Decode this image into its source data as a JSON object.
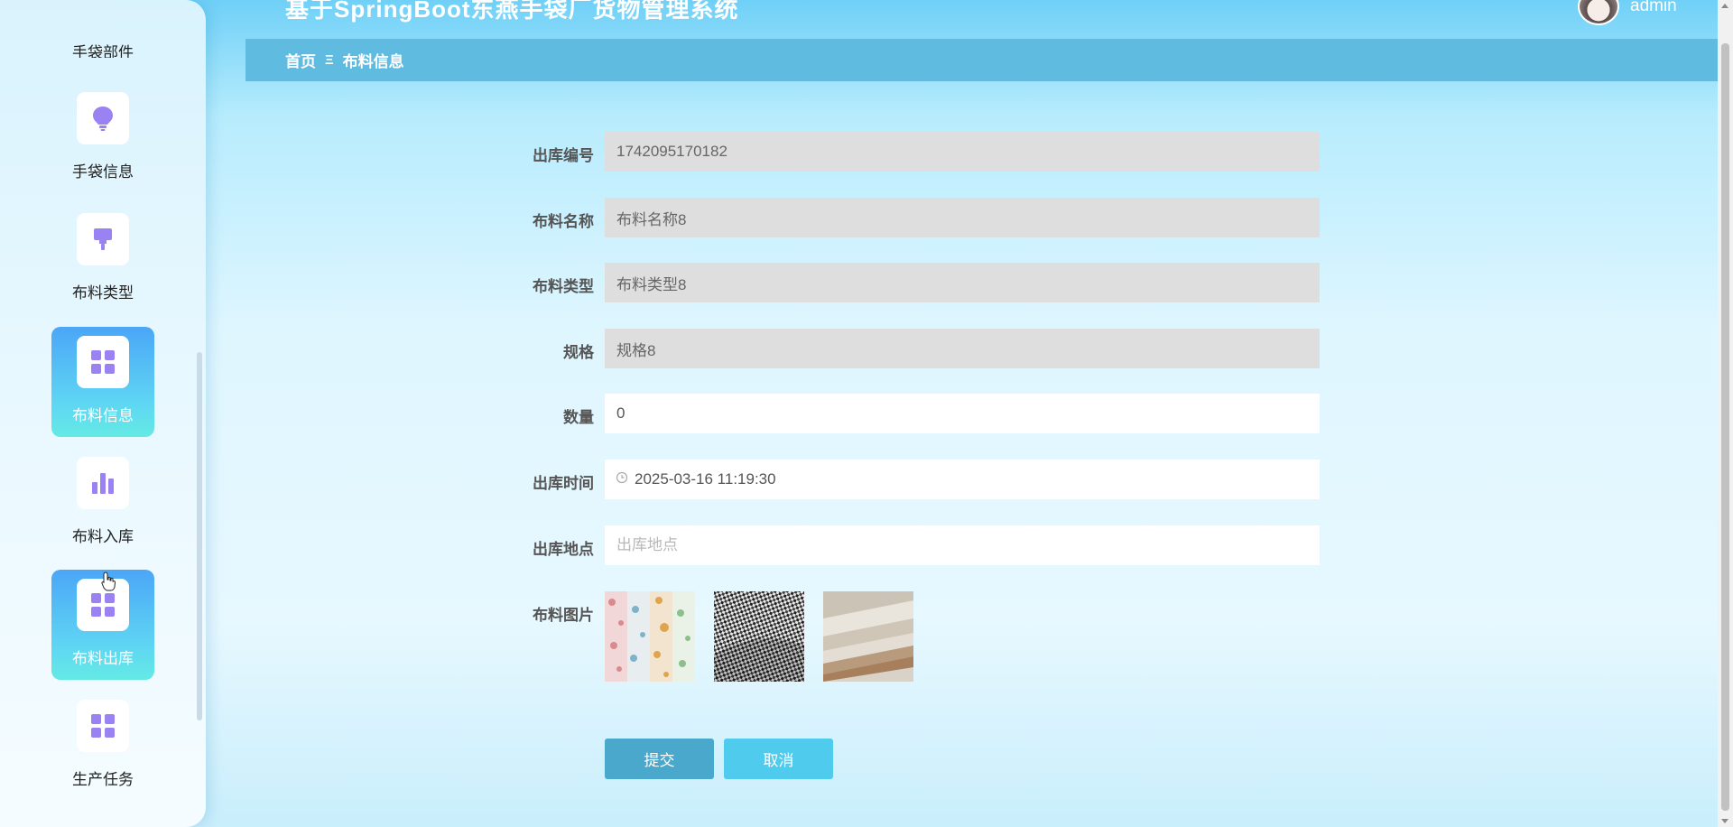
{
  "app": {
    "title": "基于SpringBoot东燕手袋厂货物管理系统",
    "user": "admin"
  },
  "sidebar": {
    "cut_label": "手袋部件",
    "items": [
      {
        "label": "手袋信息",
        "icon": "lightbulb-icon",
        "active": false
      },
      {
        "label": "布料类型",
        "icon": "brush-icon",
        "active": false
      },
      {
        "label": "布料信息",
        "icon": "grid-icon",
        "active": true
      },
      {
        "label": "布料入库",
        "icon": "bar-chart-icon",
        "active": false
      },
      {
        "label": "布料出库",
        "icon": "grid-icon",
        "active": true
      },
      {
        "label": "生产任务",
        "icon": "grid-icon",
        "active": false
      }
    ]
  },
  "breadcrumb": {
    "home": "首页",
    "separator": "Ξ",
    "current": "布料信息"
  },
  "form": {
    "out_no": {
      "label": "出库编号",
      "value": "1742095170182"
    },
    "fabric_name": {
      "label": "布料名称",
      "value": "布料名称8"
    },
    "fabric_type": {
      "label": "布料类型",
      "value": "布料类型8"
    },
    "spec": {
      "label": "规格",
      "value": "规格8"
    },
    "quantity": {
      "label": "数量",
      "value": "0"
    },
    "out_time": {
      "label": "出库时间",
      "value": "2025-03-16 11:19:30"
    },
    "out_location": {
      "label": "出库地点",
      "value": "",
      "placeholder": "出库地点"
    },
    "fabric_images": {
      "label": "布料图片"
    }
  },
  "buttons": {
    "submit": "提交",
    "cancel": "取消"
  },
  "colors": {
    "accent": "#4aa8cc",
    "cancel": "#4fcbee",
    "breadcrumb_bg": "#5fbbe0",
    "icon": "#8e7cf0"
  }
}
